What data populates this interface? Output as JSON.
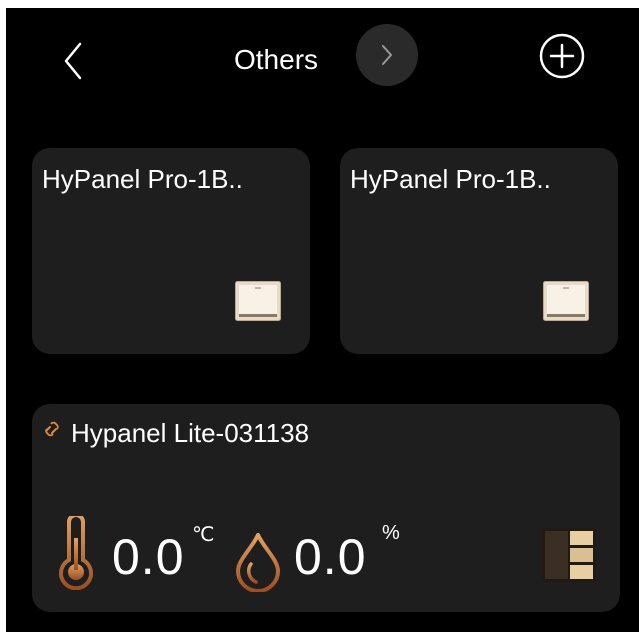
{
  "header": {
    "title": "Others"
  },
  "devices": [
    {
      "name": "HyPanel Pro-1B..",
      "icon": "light-switch-icon"
    },
    {
      "name": "HyPanel Pro-1B..",
      "icon": "light-switch-icon"
    }
  ],
  "sensor_panel": {
    "name": "Hypanel Lite-031138",
    "status_icon": "link-broken-icon",
    "temperature": "0.0",
    "temperature_unit": "℃",
    "humidity": "0.0",
    "humidity_unit": "%",
    "icon": "switch-panel-icon"
  },
  "colors": {
    "background": "#000000",
    "card": "#1e1e1e",
    "accent": "#c8773a",
    "text": "#ffffff"
  }
}
